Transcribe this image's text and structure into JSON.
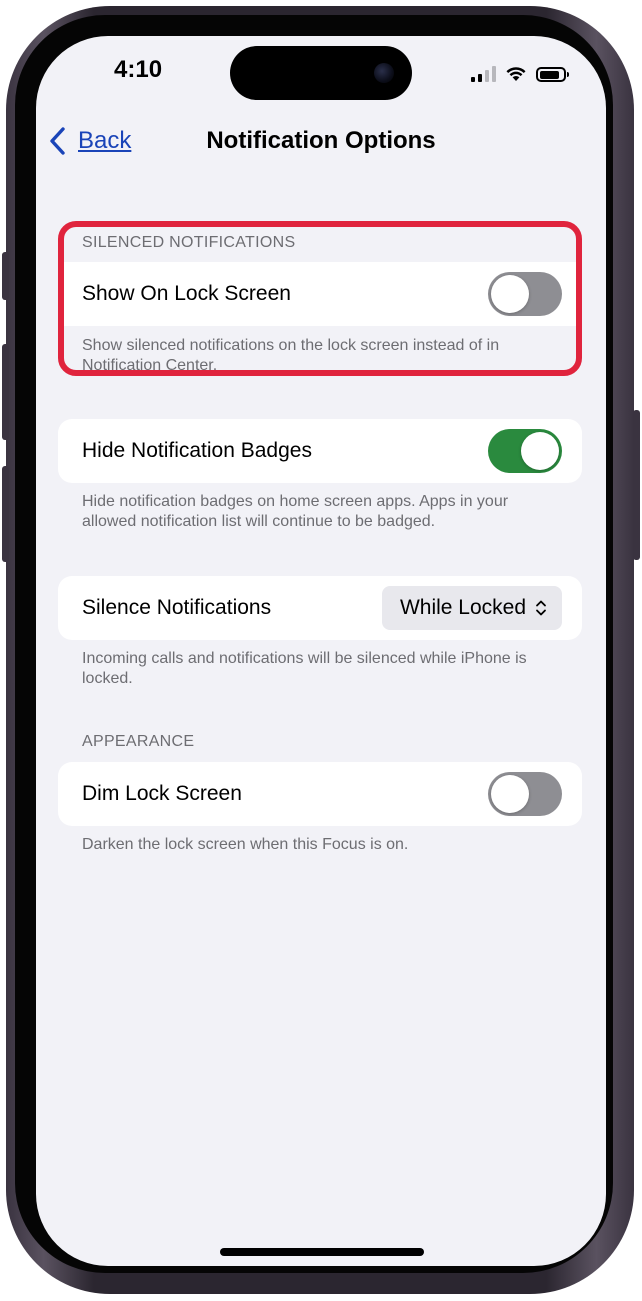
{
  "status_bar": {
    "time": "4:10",
    "icons": [
      "cellular-signal-icon",
      "wifi-icon",
      "battery-icon"
    ]
  },
  "nav": {
    "back_label": "Back",
    "title": "Notification Options"
  },
  "silenced": {
    "header": "SILENCED NOTIFICATIONS",
    "row_label": "Show On Lock Screen",
    "toggle_on": false,
    "footer": "Show silenced notifications on the lock screen instead of in Notification Center."
  },
  "badges": {
    "row_label": "Hide Notification Badges",
    "toggle_on": true,
    "footer": "Hide notification badges on home screen apps. Apps in your allowed notification list will continue to be badged."
  },
  "silence": {
    "row_label": "Silence Notifications",
    "selected": "While Locked",
    "footer": "Incoming calls and notifications will be silenced while iPhone is locked."
  },
  "appearance": {
    "header": "APPEARANCE",
    "row_label": "Dim Lock Screen",
    "toggle_on": false,
    "footer": "Darken the lock screen when this Focus is on."
  },
  "colors": {
    "accent": "#1a44b8",
    "toggle_on": "#2a8a3e",
    "toggle_off": "#8e8e93",
    "highlight": "#e0243d",
    "background": "#f2f2f7"
  }
}
